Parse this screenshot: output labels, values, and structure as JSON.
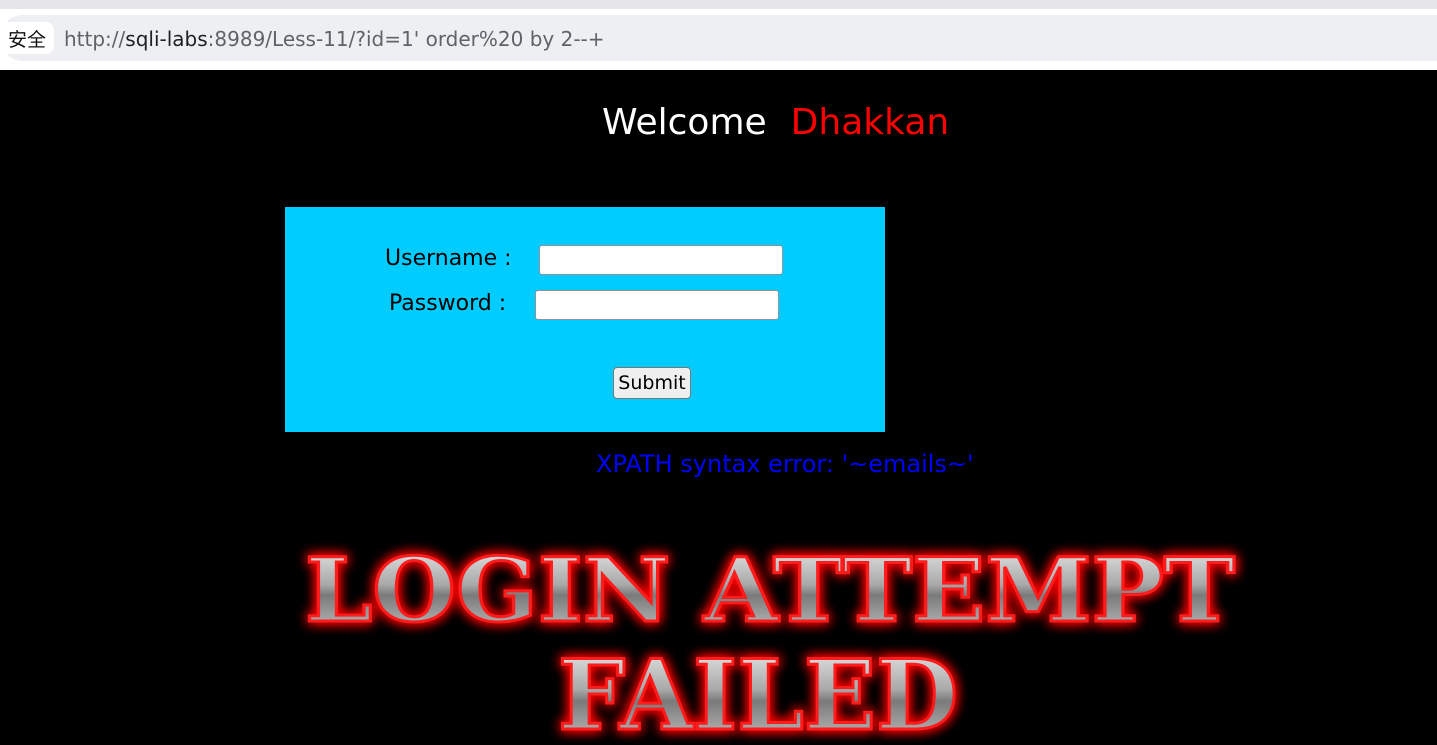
{
  "browser": {
    "security_label": "安全",
    "url_prefix": "http://",
    "url_host": "sqli-labs",
    "url_rest": ":8989/Less-11/?id=1' order%20 by 2--+"
  },
  "welcome": {
    "greeting": "Welcome",
    "name": "Dhakkan",
    "name_color": "#ff0000"
  },
  "login_form": {
    "bg_color": "#00ccff",
    "username_label": "Username :",
    "username_value": "",
    "password_label": "Password :",
    "password_value": "",
    "submit_label": "Submit"
  },
  "error_message": {
    "text": "XPATH syntax error: '~emails~'",
    "color": "#0000ff"
  },
  "result_image": {
    "line1": "LOGIN ATTEMPT",
    "line2": "FAILED",
    "glow_color": "#ff0000"
  }
}
